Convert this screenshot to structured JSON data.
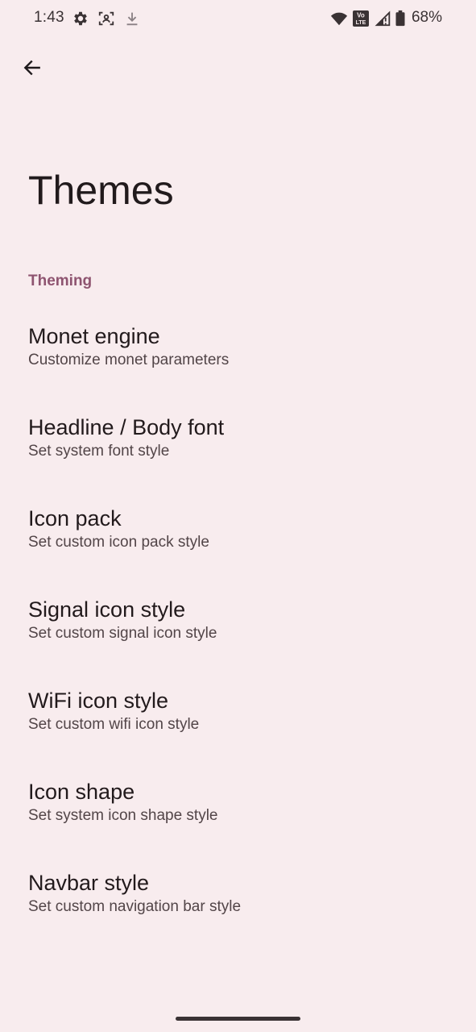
{
  "status_bar": {
    "time": "1:43",
    "battery_percent": "68%",
    "left_icons": [
      "gear-icon",
      "face-scan-icon",
      "download-icon"
    ],
    "right_icons": [
      "wifi-icon",
      "volte-icon",
      "signal-icon",
      "battery-icon"
    ],
    "volte_top": "Vo",
    "volte_bottom": "LTE"
  },
  "header": {
    "back_icon": "arrow-left-icon",
    "title": "Themes"
  },
  "section": {
    "header": "Theming",
    "items": [
      {
        "title": "Monet engine",
        "summary": "Customize monet parameters"
      },
      {
        "title": "Headline / Body font",
        "summary": "Set system font style"
      },
      {
        "title": "Icon pack",
        "summary": "Set custom icon pack style"
      },
      {
        "title": "Signal icon style",
        "summary": "Set custom signal icon style"
      },
      {
        "title": "WiFi icon style",
        "summary": "Set custom wifi icon style"
      },
      {
        "title": "Icon shape",
        "summary": "Set system icon shape style"
      },
      {
        "title": "Navbar style",
        "summary": "Set custom navigation bar style"
      }
    ]
  },
  "colors": {
    "background": "#f8ecee",
    "accent": "#8e5470",
    "title_text": "#221a1c",
    "summary_text": "#524548"
  }
}
